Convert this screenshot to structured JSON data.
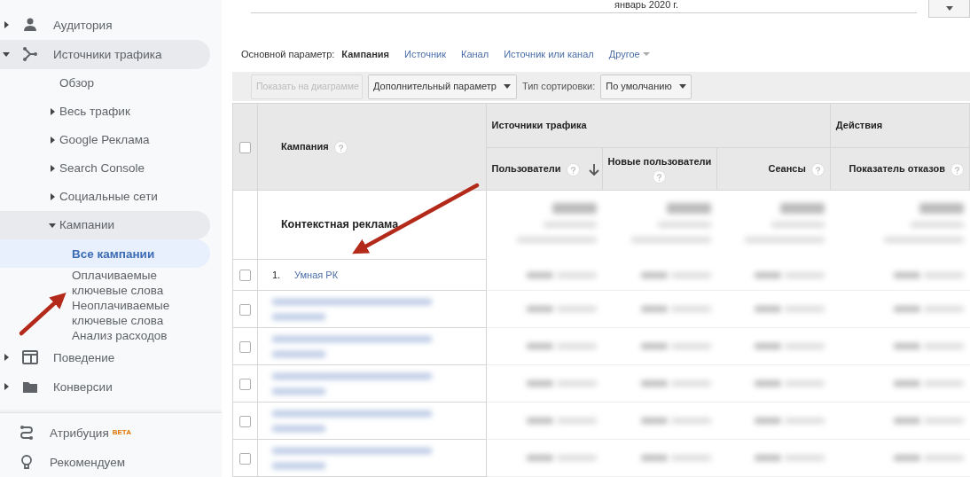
{
  "sidebar": {
    "items": [
      {
        "label": "Аудитория",
        "expanded": false
      },
      {
        "label": "Источники трафика",
        "expanded": true,
        "children": [
          {
            "label": "Обзор"
          },
          {
            "label": "Весь трафик",
            "expanded": false
          },
          {
            "label": "Google Реклама",
            "expanded": false
          },
          {
            "label": "Search Console",
            "expanded": false
          },
          {
            "label": "Социальные сети",
            "expanded": false
          },
          {
            "label": "Кампании",
            "expanded": true,
            "children": [
              {
                "label": "Все кампании",
                "selected": true
              },
              {
                "label": "Оплачиваемые ключевые слова",
                "selected": false
              },
              {
                "label": "Неоплачиваемые ключевые слова",
                "selected": false
              },
              {
                "label": "Анализ расходов",
                "selected": false
              }
            ]
          }
        ]
      },
      {
        "label": "Поведение",
        "expanded": false
      },
      {
        "label": "Конверсии",
        "expanded": false
      }
    ],
    "bottom_items": [
      {
        "label": "Атрибуция",
        "badge": "BETA"
      },
      {
        "label": "Рекомендуем"
      }
    ]
  },
  "period_label": "январь 2020 г.",
  "primary_dimension": {
    "label": "Основной параметр:",
    "options": [
      {
        "label": "Кампания",
        "selected": true
      },
      {
        "label": "Источник",
        "selected": false
      },
      {
        "label": "Канал",
        "selected": false
      },
      {
        "label": "Источник или канал",
        "selected": false
      },
      {
        "label": "Другое",
        "selected": false,
        "kind": "menu"
      }
    ]
  },
  "toolbar": {
    "plot_button": {
      "label": "Показать на диаграмме",
      "disabled": true
    },
    "secondary_dimension": "Дополнительный параметр",
    "sort_label": "Тип сортировки:",
    "sort_value": "По умолчанию"
  },
  "table": {
    "select_all_checked": false,
    "dimension_column": "Кампания",
    "groups": [
      {
        "label": "Источники трафика"
      },
      {
        "label": "Действия"
      }
    ],
    "columns": [
      {
        "label": "Пользователи",
        "sorted": true
      },
      {
        "label": "Новые пользователи",
        "sorted": false
      },
      {
        "label": "Сеансы",
        "sorted": false
      },
      {
        "label": "Показатель отказов",
        "sorted": false
      }
    ],
    "summary_label": "Контекстная реклама",
    "rows": [
      {
        "kind": "visible",
        "index": "1.",
        "name": "Умная РК",
        "checked": false
      },
      {
        "kind": "blurred",
        "checked": false
      },
      {
        "kind": "blurred",
        "checked": false
      },
      {
        "kind": "blurred",
        "checked": false
      },
      {
        "kind": "blurred",
        "checked": false
      },
      {
        "kind": "blurred",
        "checked": false
      }
    ]
  }
}
